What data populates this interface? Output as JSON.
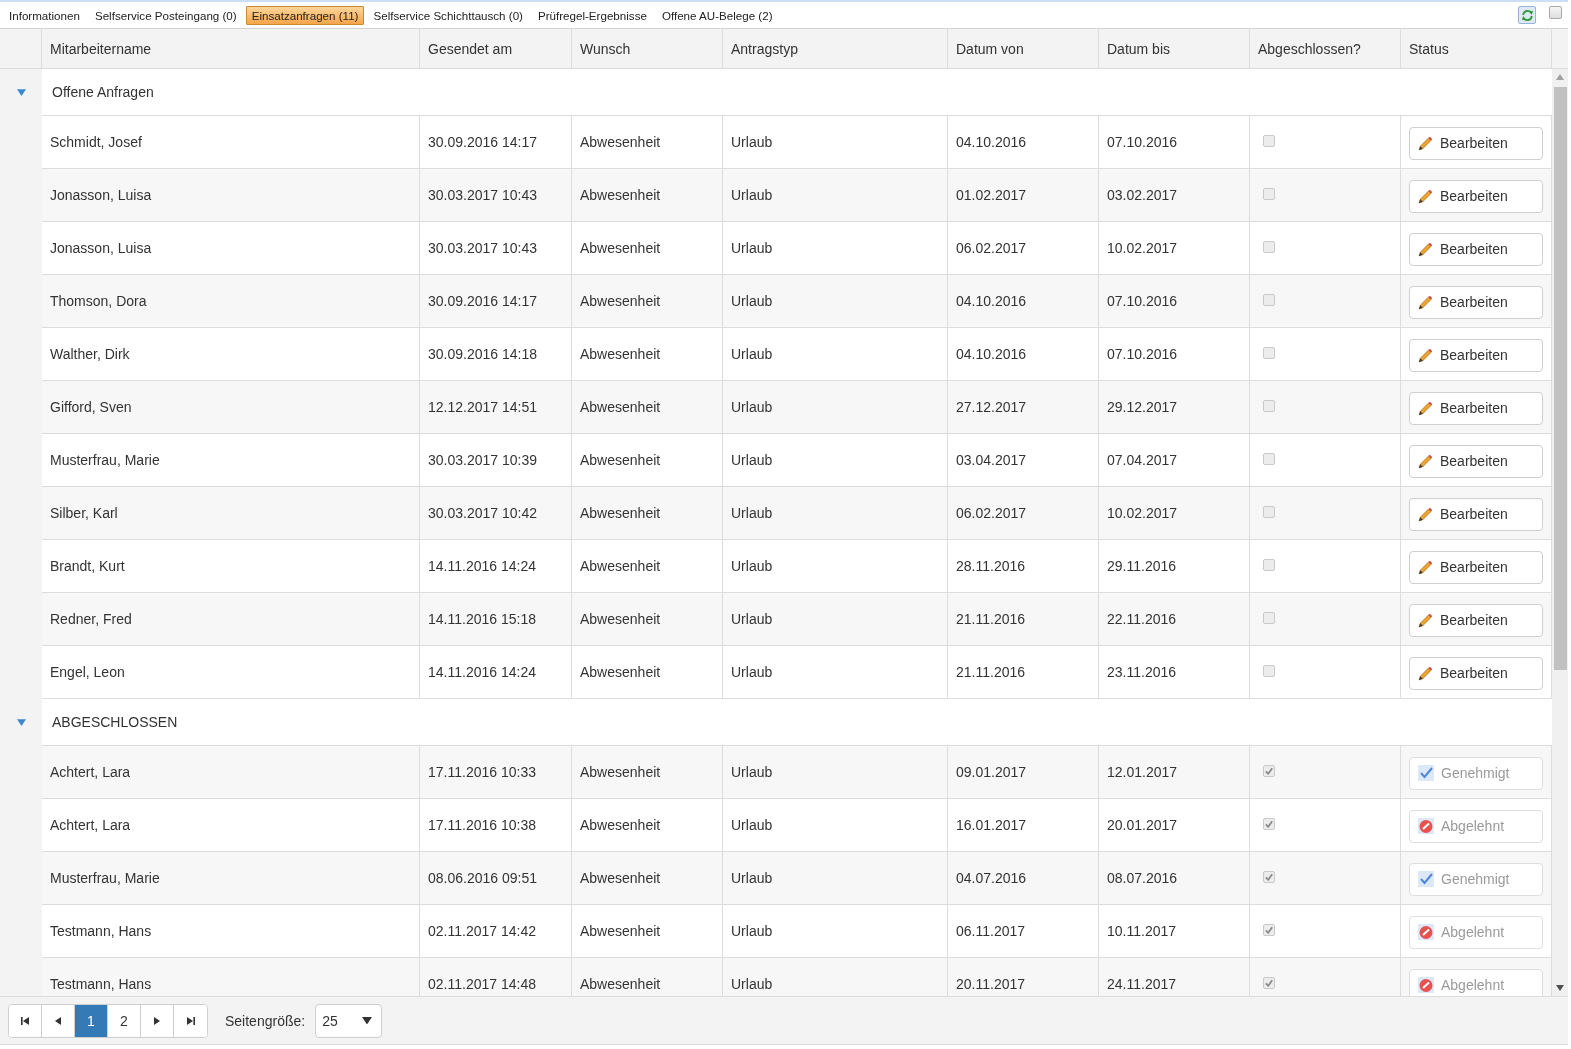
{
  "tabs": [
    {
      "label": "Informationen",
      "selected": false
    },
    {
      "label": "Selfservice Posteingang (0)",
      "selected": false
    },
    {
      "label": "Einsatzanfragen (11)",
      "selected": true
    },
    {
      "label": "Selfservice Schichttausch (0)",
      "selected": false
    },
    {
      "label": "Prüfregel-Ergebnisse",
      "selected": false
    },
    {
      "label": "Offene AU-Belege (2)",
      "selected": false
    }
  ],
  "corner_checkbox": {
    "checked": false
  },
  "table": {
    "columns": [
      "Mitarbeitername",
      "Gesendet am",
      "Wunsch",
      "Antragstyp",
      "Datum von",
      "Datum bis",
      "Abgeschlossen?",
      "Status"
    ],
    "groups": [
      {
        "title": "Offene Anfragen",
        "expanded": true,
        "rows": [
          {
            "name": "Schmidt, Josef",
            "sent": "30.09.2016 14:17",
            "wish": "Abwesenheit",
            "type": "Urlaub",
            "from": "04.10.2016",
            "to": "07.10.2016",
            "closed": false,
            "status": {
              "kind": "edit",
              "label": "Bearbeiten",
              "disabled": false
            }
          },
          {
            "name": "Jonasson, Luisa",
            "sent": "30.03.2017 10:43",
            "wish": "Abwesenheit",
            "type": "Urlaub",
            "from": "01.02.2017",
            "to": "03.02.2017",
            "closed": false,
            "status": {
              "kind": "edit",
              "label": "Bearbeiten",
              "disabled": false
            }
          },
          {
            "name": "Jonasson, Luisa",
            "sent": "30.03.2017 10:43",
            "wish": "Abwesenheit",
            "type": "Urlaub",
            "from": "06.02.2017",
            "to": "10.02.2017",
            "closed": false,
            "status": {
              "kind": "edit",
              "label": "Bearbeiten",
              "disabled": false
            }
          },
          {
            "name": "Thomson, Dora",
            "sent": "30.09.2016 14:17",
            "wish": "Abwesenheit",
            "type": "Urlaub",
            "from": "04.10.2016",
            "to": "07.10.2016",
            "closed": false,
            "status": {
              "kind": "edit",
              "label": "Bearbeiten",
              "disabled": false
            }
          },
          {
            "name": "Walther, Dirk",
            "sent": "30.09.2016 14:18",
            "wish": "Abwesenheit",
            "type": "Urlaub",
            "from": "04.10.2016",
            "to": "07.10.2016",
            "closed": false,
            "status": {
              "kind": "edit",
              "label": "Bearbeiten",
              "disabled": false
            }
          },
          {
            "name": "Gifford, Sven",
            "sent": "12.12.2017 14:51",
            "wish": "Abwesenheit",
            "type": "Urlaub",
            "from": "27.12.2017",
            "to": "29.12.2017",
            "closed": false,
            "status": {
              "kind": "edit",
              "label": "Bearbeiten",
              "disabled": false
            }
          },
          {
            "name": "Musterfrau, Marie",
            "sent": "30.03.2017 10:39",
            "wish": "Abwesenheit",
            "type": "Urlaub",
            "from": "03.04.2017",
            "to": "07.04.2017",
            "closed": false,
            "status": {
              "kind": "edit",
              "label": "Bearbeiten",
              "disabled": false
            }
          },
          {
            "name": "Silber, Karl",
            "sent": "30.03.2017 10:42",
            "wish": "Abwesenheit",
            "type": "Urlaub",
            "from": "06.02.2017",
            "to": "10.02.2017",
            "closed": false,
            "status": {
              "kind": "edit",
              "label": "Bearbeiten",
              "disabled": false
            }
          },
          {
            "name": "Brandt, Kurt",
            "sent": "14.11.2016 14:24",
            "wish": "Abwesenheit",
            "type": "Urlaub",
            "from": "28.11.2016",
            "to": "29.11.2016",
            "closed": false,
            "status": {
              "kind": "edit",
              "label": "Bearbeiten",
              "disabled": false
            }
          },
          {
            "name": "Redner, Fred",
            "sent": "14.11.2016 15:18",
            "wish": "Abwesenheit",
            "type": "Urlaub",
            "from": "21.11.2016",
            "to": "22.11.2016",
            "closed": false,
            "status": {
              "kind": "edit",
              "label": "Bearbeiten",
              "disabled": false
            }
          },
          {
            "name": "Engel, Leon",
            "sent": "14.11.2016 14:24",
            "wish": "Abwesenheit",
            "type": "Urlaub",
            "from": "21.11.2016",
            "to": "23.11.2016",
            "closed": false,
            "status": {
              "kind": "edit",
              "label": "Bearbeiten",
              "disabled": false
            }
          }
        ]
      },
      {
        "title": "ABGESCHLOSSEN",
        "expanded": true,
        "rows": [
          {
            "name": "Achtert, Lara",
            "sent": "17.11.2016 10:33",
            "wish": "Abwesenheit",
            "type": "Urlaub",
            "from": "09.01.2017",
            "to": "12.01.2017",
            "closed": true,
            "status": {
              "kind": "approved",
              "label": "Genehmigt",
              "disabled": true
            }
          },
          {
            "name": "Achtert, Lara",
            "sent": "17.11.2016 10:38",
            "wish": "Abwesenheit",
            "type": "Urlaub",
            "from": "16.01.2017",
            "to": "20.01.2017",
            "closed": true,
            "status": {
              "kind": "rejected",
              "label": "Abgelehnt",
              "disabled": true
            }
          },
          {
            "name": "Musterfrau, Marie",
            "sent": "08.06.2016 09:51",
            "wish": "Abwesenheit",
            "type": "Urlaub",
            "from": "04.07.2016",
            "to": "08.07.2016",
            "closed": true,
            "status": {
              "kind": "approved",
              "label": "Genehmigt",
              "disabled": true
            }
          },
          {
            "name": "Testmann, Hans",
            "sent": "02.11.2017 14:42",
            "wish": "Abwesenheit",
            "type": "Urlaub",
            "from": "06.11.2017",
            "to": "10.11.2017",
            "closed": true,
            "status": {
              "kind": "rejected",
              "label": "Abgelehnt",
              "disabled": true
            }
          },
          {
            "name": "Testmann, Hans",
            "sent": "02.11.2017 14:48",
            "wish": "Abwesenheit",
            "type": "Urlaub",
            "from": "20.11.2017",
            "to": "24.11.2017",
            "closed": true,
            "status": {
              "kind": "rejected",
              "label": "Abgelehnt",
              "disabled": true
            }
          }
        ]
      }
    ]
  },
  "pager": {
    "pages": [
      {
        "label": "1",
        "selected": true
      },
      {
        "label": "2",
        "selected": false
      }
    ],
    "page_size_label": "Seitengröße:",
    "page_size": "25"
  }
}
